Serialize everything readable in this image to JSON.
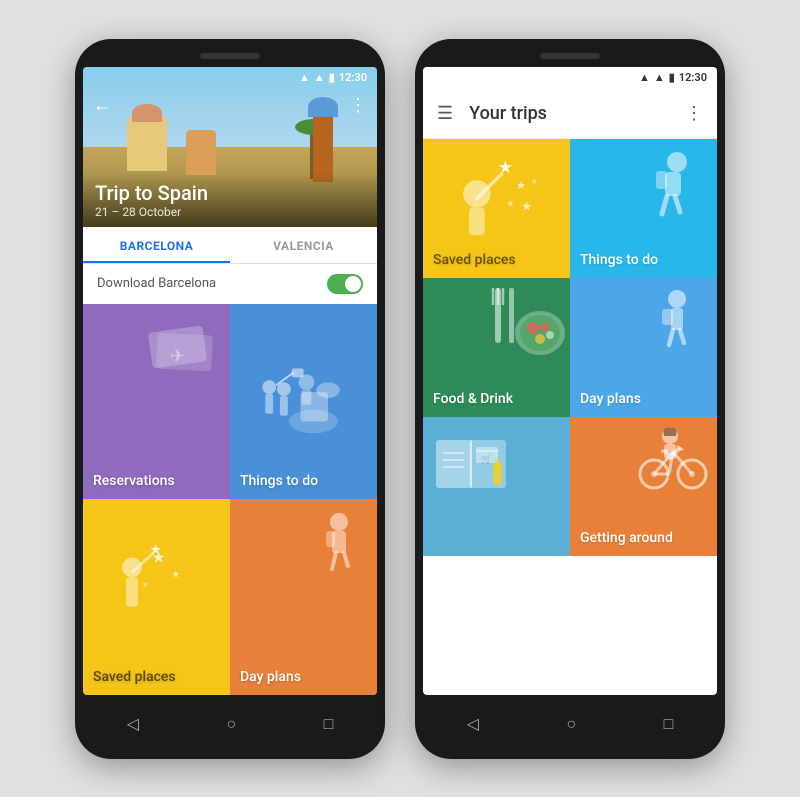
{
  "phone1": {
    "status_time": "12:30",
    "trip_title": "Trip to Spain",
    "trip_dates": "21 – 28 October",
    "tabs": [
      "BARCELONA",
      "VALENCIA"
    ],
    "active_tab": "BARCELONA",
    "download_label": "Download Barcelona",
    "tiles": [
      {
        "id": "reservations",
        "label": "Reservations",
        "color": "purple"
      },
      {
        "id": "things-to-do",
        "label": "Things to do",
        "color": "blue"
      },
      {
        "id": "saved-places",
        "label": "Saved places",
        "color": "yellow"
      },
      {
        "id": "day-plans",
        "label": "Day plans",
        "color": "orange"
      }
    ]
  },
  "phone2": {
    "status_time": "12:30",
    "header_title": "Your trips",
    "tiles": [
      {
        "id": "saved-places",
        "label": "Saved places",
        "color": "yellow"
      },
      {
        "id": "things-to-do",
        "label": "Things to do",
        "color": "blue-light"
      },
      {
        "id": "food-drink",
        "label": "Food & Drink",
        "color": "green"
      },
      {
        "id": "day-plans",
        "label": "Day plans",
        "color": "blue2"
      },
      {
        "id": "explore",
        "label": "",
        "color": "blue3"
      },
      {
        "id": "getting-around",
        "label": "Getting around",
        "color": "orange"
      }
    ]
  },
  "nav": {
    "back": "◁",
    "home": "○",
    "recent": "□"
  }
}
